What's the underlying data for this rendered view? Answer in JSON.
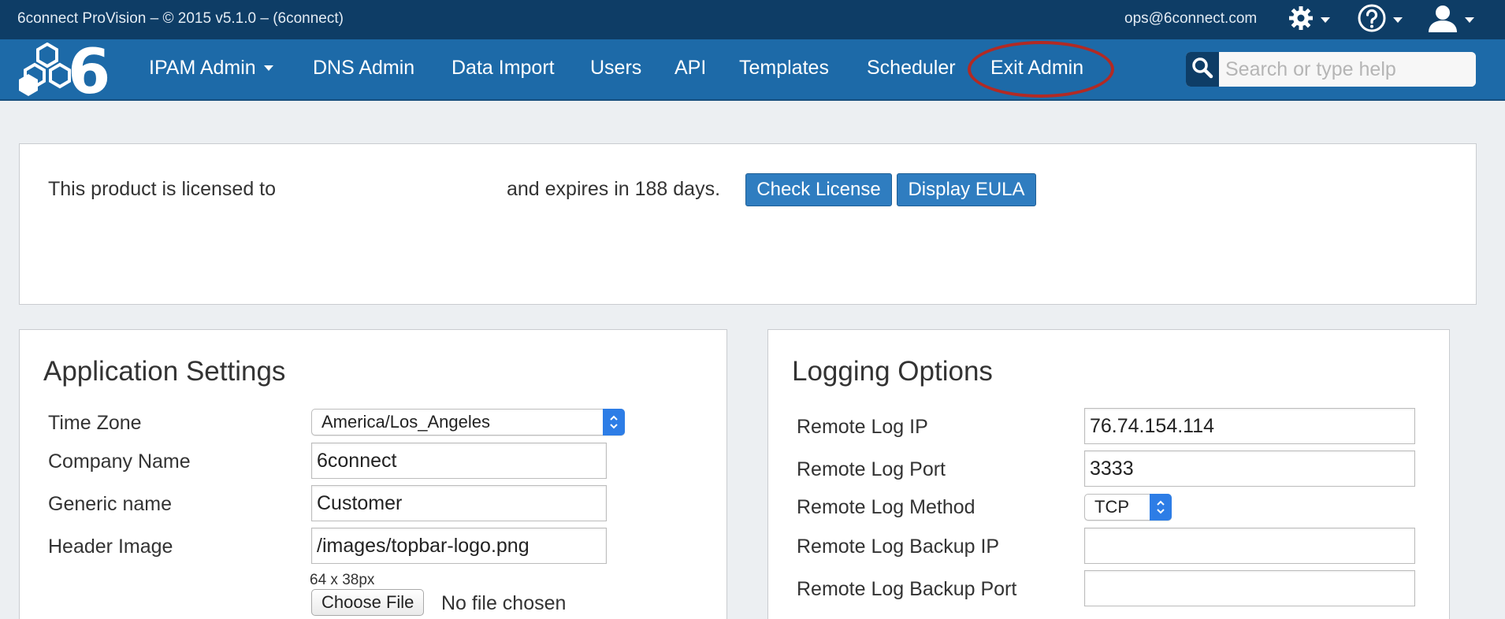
{
  "topbar": {
    "app_title": "6connect ProVision – © 2015 v5.1.0 – (6connect)",
    "user_email": "ops@6connect.com",
    "icons": [
      "gear-icon",
      "help-icon",
      "user-icon"
    ]
  },
  "nav": {
    "logo": "6connect-logo",
    "items": [
      {
        "label": "IPAM Admin",
        "dropdown": true
      },
      {
        "label": "DNS Admin"
      },
      {
        "label": "Data Import"
      },
      {
        "label": "Users"
      },
      {
        "label": "API"
      },
      {
        "label": "Templates"
      },
      {
        "label": "Scheduler"
      },
      {
        "label": "Exit Admin",
        "highlighted": true
      }
    ],
    "search_placeholder": "Search or type help"
  },
  "license": {
    "text_prefix": "This product is licensed to",
    "text_suffix": "and expires in 188 days.",
    "check_button": "Check License",
    "eula_button": "Display EULA"
  },
  "app_settings": {
    "title": "Application Settings",
    "time_zone_label": "Time Zone",
    "time_zone_value": "America/Los_Angeles",
    "company_name_label": "Company Name",
    "company_name_value": "6connect",
    "generic_name_label": "Generic name",
    "generic_name_value": "Customer",
    "header_image_label": "Header Image",
    "header_image_value": "/images/topbar-logo.png",
    "image_size_hint": "64 x 38px",
    "choose_file_button": "Choose File",
    "file_status": "No file chosen"
  },
  "logging": {
    "title": "Logging Options",
    "remote_log_ip_label": "Remote Log IP",
    "remote_log_ip_value": "76.74.154.114",
    "remote_log_port_label": "Remote Log Port",
    "remote_log_port_value": "3333",
    "remote_log_method_label": "Remote Log Method",
    "remote_log_method_value": "TCP",
    "backup_ip_label": "Remote Log Backup IP",
    "backup_ip_value": "",
    "backup_port_label": "Remote Log Backup Port",
    "backup_port_value": ""
  },
  "colors": {
    "topbar": "#0e3d66",
    "navbar": "#1d6aa8",
    "button": "#2f7dc0",
    "highlight_ring": "#b22a24"
  }
}
